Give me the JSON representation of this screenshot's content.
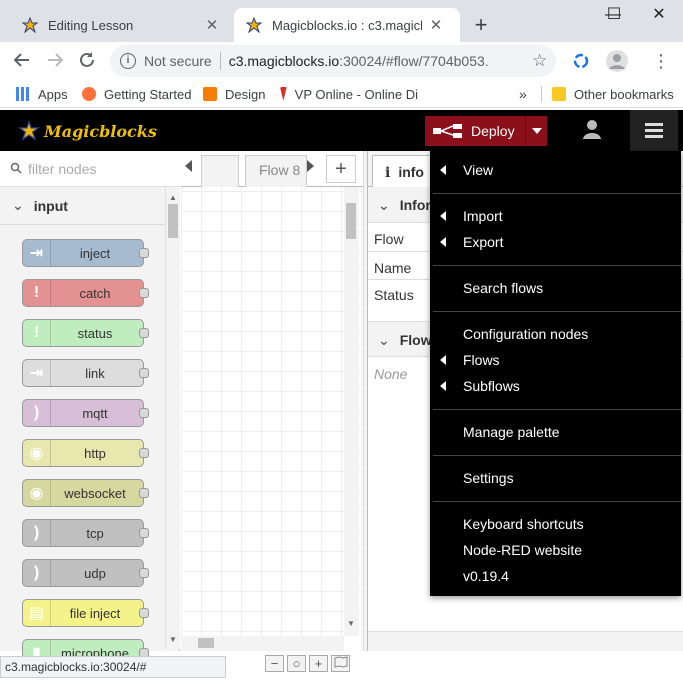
{
  "browser": {
    "tabs": [
      {
        "title": "Editing Lesson",
        "close": "✕"
      },
      {
        "title": "Magicblocks.io : c3.magicblocks",
        "close": "✕"
      }
    ],
    "new_tab": "+",
    "window_controls": {
      "minimize": "—",
      "maximize": "☐",
      "close": "✕"
    },
    "address": {
      "security_label": "Not secure",
      "host": "c3.magicblocks.io",
      "path": ":30024/#flow/7704b053.96..."
    },
    "bookmarks": [
      {
        "label": "Apps",
        "color": "#4285f4"
      },
      {
        "label": "Getting Started",
        "color": "#ff7139"
      },
      {
        "label": "Design",
        "color": "#f57d00"
      },
      {
        "label": "VP Online - Online Di",
        "color": "#d93025"
      }
    ],
    "bookmarks_more": "»",
    "other_bookmarks": "Other bookmarks",
    "status_url": "c3.magicblocks.io:30024/#"
  },
  "app": {
    "logo_text": "Magicblocks",
    "deploy_label": "Deploy",
    "palette": {
      "filter_placeholder": "filter nodes",
      "category": "input",
      "nodes": [
        {
          "label": "inject",
          "color": "#a6bbcf",
          "glyph": "⇥"
        },
        {
          "label": "catch",
          "color": "#e49191",
          "glyph": "!"
        },
        {
          "label": "status",
          "color": "#c0edc0",
          "glyph": "!"
        },
        {
          "label": "link",
          "color": "#dddddd",
          "glyph": "⇥"
        },
        {
          "label": "mqtt",
          "color": "#d8bfd8",
          "glyph": ")"
        },
        {
          "label": "http",
          "color": "#e7e7ae",
          "glyph": "◉"
        },
        {
          "label": "websocket",
          "color": "#d7d7a0",
          "glyph": "◉"
        },
        {
          "label": "tcp",
          "color": "#c0c0c0",
          "glyph": ")"
        },
        {
          "label": "udp",
          "color": "#c0c0c0",
          "glyph": ")"
        },
        {
          "label": "file inject",
          "color": "#f3f38a",
          "glyph": "▤"
        },
        {
          "label": "microphone",
          "color": "#c0edc0",
          "glyph": "▮"
        }
      ]
    },
    "workspace": {
      "tab_label": "Flow 8",
      "add_tab": "+"
    },
    "sidebar": {
      "tab_label": "info",
      "section_info": "Infor",
      "rows": [
        {
          "label": "Flow"
        },
        {
          "label": "Name"
        },
        {
          "label": "Status"
        }
      ],
      "section_flow": "Flow",
      "none_text": "None"
    },
    "zoom": {
      "out": "−",
      "reset": "○",
      "in": "+"
    },
    "menu": {
      "items": [
        {
          "label": "View",
          "arrow": true
        },
        {
          "label": "Import",
          "arrow": true
        },
        {
          "label": "Export",
          "arrow": true
        },
        {
          "label": "Search flows",
          "arrow": false
        },
        {
          "label": "Configuration nodes",
          "arrow": false
        },
        {
          "label": "Flows",
          "arrow": true
        },
        {
          "label": "Subflows",
          "arrow": true
        },
        {
          "label": "Manage palette",
          "arrow": false
        },
        {
          "label": "Settings",
          "arrow": false
        },
        {
          "label": "Keyboard shortcuts",
          "arrow": false
        },
        {
          "label": "Node-RED website",
          "arrow": false
        },
        {
          "label": "v0.19.4",
          "arrow": false
        }
      ]
    }
  }
}
